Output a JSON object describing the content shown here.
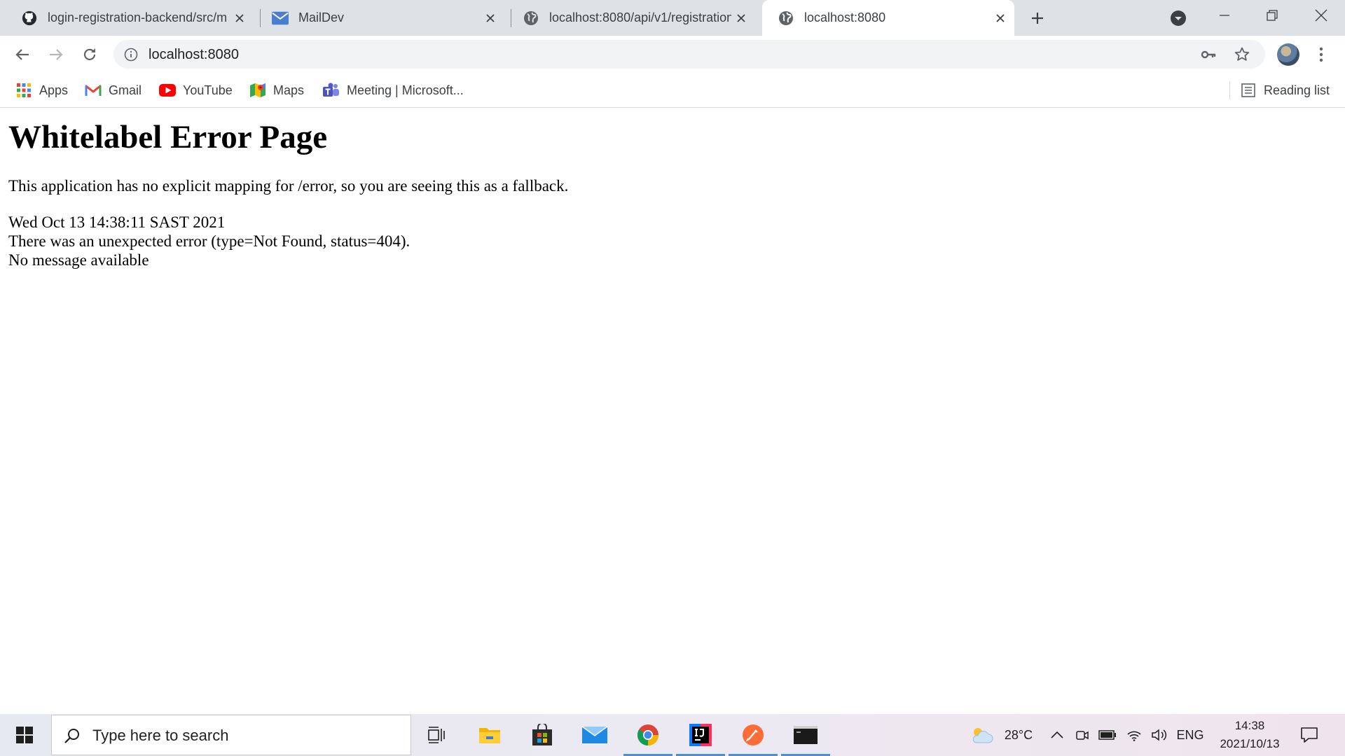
{
  "browser": {
    "tabs": [
      {
        "title": "login-registration-backend/src/m",
        "icon": "github-icon",
        "active": false
      },
      {
        "title": "MailDev",
        "icon": "mail-icon",
        "active": false
      },
      {
        "title": "localhost:8080/api/v1/registration",
        "icon": "globe-icon",
        "active": false
      },
      {
        "title": "localhost:8080",
        "icon": "globe-icon",
        "active": true
      }
    ],
    "url": "localhost:8080",
    "bookmarks": [
      {
        "label": "Apps",
        "icon": "apps-grid-icon"
      },
      {
        "label": "Gmail",
        "icon": "gmail-icon"
      },
      {
        "label": "YouTube",
        "icon": "youtube-icon"
      },
      {
        "label": "Maps",
        "icon": "maps-icon"
      },
      {
        "label": "Meeting | Microsoft...",
        "icon": "teams-icon"
      }
    ],
    "reading_list": "Reading list"
  },
  "page": {
    "heading": "Whitelabel Error Page",
    "message": "This application has no explicit mapping for /error, so you are seeing this as a fallback.",
    "timestamp": "Wed Oct 13 14:38:11 SAST 2021",
    "error": "There was an unexpected error (type=Not Found, status=404).",
    "detail": "No message available"
  },
  "taskbar": {
    "search_placeholder": "Type here to search",
    "apps": [
      "task-view-icon",
      "file-explorer-icon",
      "store-icon",
      "mail-app-icon",
      "chrome-icon",
      "intellij-icon",
      "postman-icon",
      "terminal-icon"
    ],
    "weather": "28°C",
    "language": "ENG",
    "time": "14:38",
    "date": "2021/10/13"
  },
  "colors": {
    "tabstrip_bg": "#dee1e6",
    "omnibox_bg": "#f1f3f4",
    "running_indicator": "#4a90d9"
  }
}
